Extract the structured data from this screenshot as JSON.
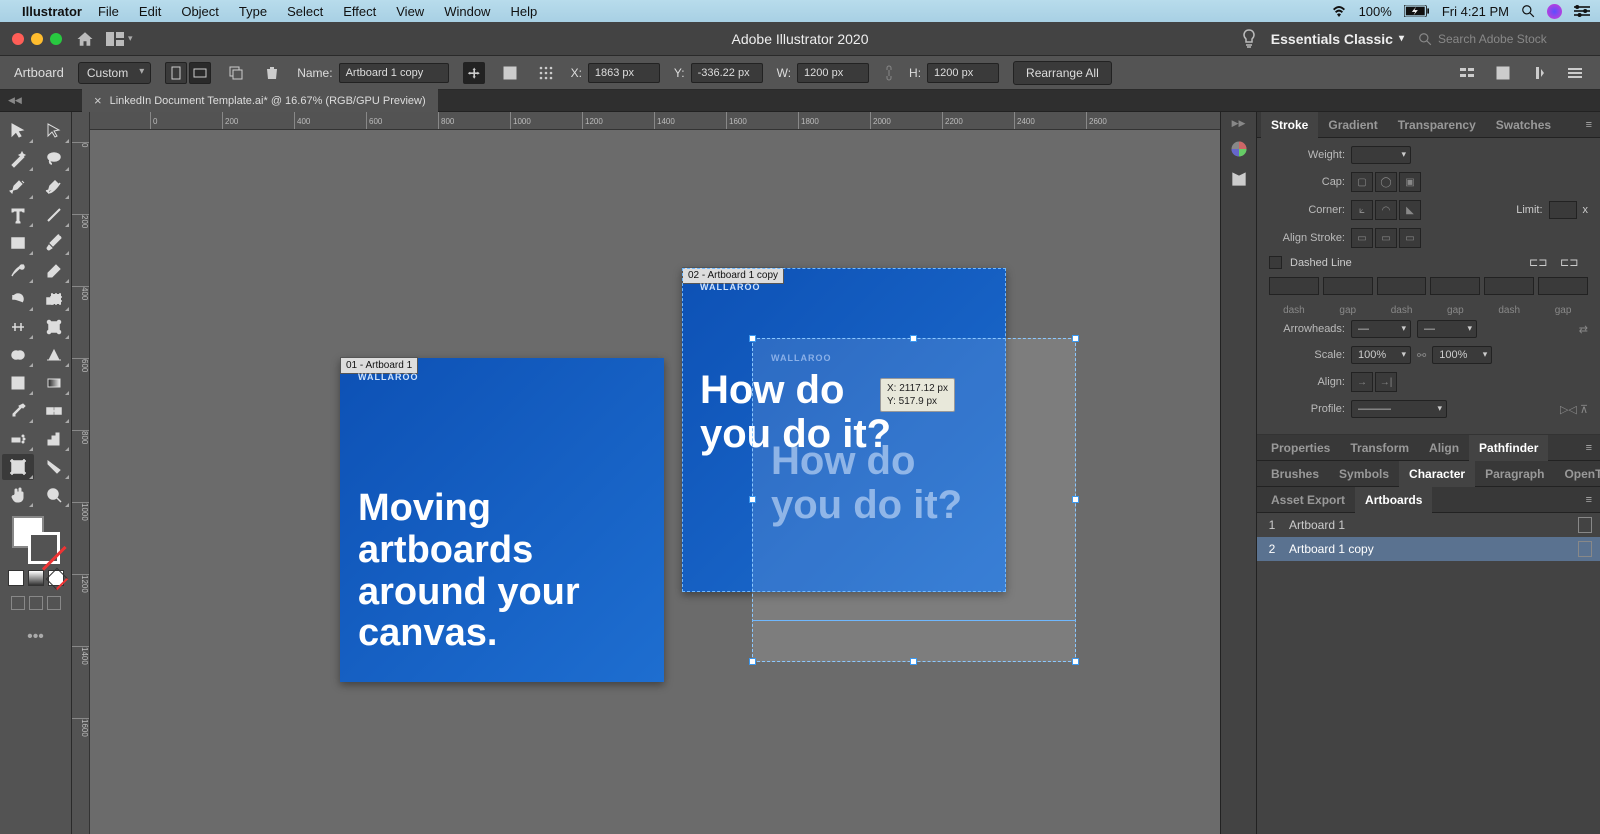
{
  "menubar": {
    "app": "Illustrator",
    "items": [
      "File",
      "Edit",
      "Object",
      "Type",
      "Select",
      "Effect",
      "View",
      "Window",
      "Help"
    ],
    "battery": "100%",
    "clock": "Fri 4:21 PM"
  },
  "chrome": {
    "title": "Adobe Illustrator 2020",
    "workspace": "Essentials Classic",
    "search_placeholder": "Search Adobe Stock"
  },
  "controlbar": {
    "mode_label": "Artboard",
    "preset": "Custom",
    "name_label": "Name:",
    "name_value": "Artboard 1 copy",
    "x_label": "X:",
    "x_value": "1863 px",
    "y_label": "Y:",
    "y_value": "-336.22 px",
    "w_label": "W:",
    "w_value": "1200 px",
    "h_label": "H:",
    "h_value": "1200 px",
    "rearrange": "Rearrange All"
  },
  "tab": {
    "title": "LinkedIn Document Template.ai* @ 16.67% (RGB/GPU Preview)"
  },
  "hruler_ticks": [
    "0",
    "200",
    "400",
    "600",
    "800",
    "1000",
    "1200",
    "1400",
    "1600",
    "1800",
    "2000",
    "2200",
    "2400",
    "2600"
  ],
  "vruler_ticks": [
    "0",
    "200",
    "400",
    "600",
    "800",
    "1000",
    "1200",
    "1400",
    "1600"
  ],
  "artboards": {
    "ab1": {
      "label": "01 - Artboard 1",
      "brand": "WALLAROO",
      "text": "Moving\nartboards\naround your\ncanvas."
    },
    "ab2": {
      "label": "02 - Artboard 1 copy",
      "brand": "WALLAROO",
      "text": "How do\nyou do it?"
    },
    "ghost": {
      "brand": "WALLAROO",
      "text": "How do\nyou do it?"
    }
  },
  "tooltip": {
    "x": "X: 2117.12 px",
    "y": "Y: 517.9 px"
  },
  "panel_stroke": {
    "tabs": [
      "Stroke",
      "Gradient",
      "Transparency",
      "Swatches"
    ],
    "weight": "Weight:",
    "cap": "Cap:",
    "corner": "Corner:",
    "limit": "Limit:",
    "limit_suffix": "x",
    "align": "Align Stroke:",
    "dashed": "Dashed Line",
    "dash_labels": [
      "dash",
      "gap",
      "dash",
      "gap",
      "dash",
      "gap"
    ],
    "arrowheads": "Arrowheads:",
    "scale": "Scale:",
    "scale_val": "100%",
    "align2": "Align:",
    "profile": "Profile:"
  },
  "panel_props": {
    "tabs": [
      "Properties",
      "Transform",
      "Align",
      "Pathfinder"
    ]
  },
  "panel_brush": {
    "tabs": [
      "Brushes",
      "Symbols",
      "Character",
      "Paragraph",
      "OpenType"
    ]
  },
  "panel_asset": {
    "tabs": [
      "Asset Export",
      "Artboards"
    ]
  },
  "artboard_list": [
    {
      "idx": "1",
      "name": "Artboard 1"
    },
    {
      "idx": "2",
      "name": "Artboard 1 copy"
    }
  ]
}
